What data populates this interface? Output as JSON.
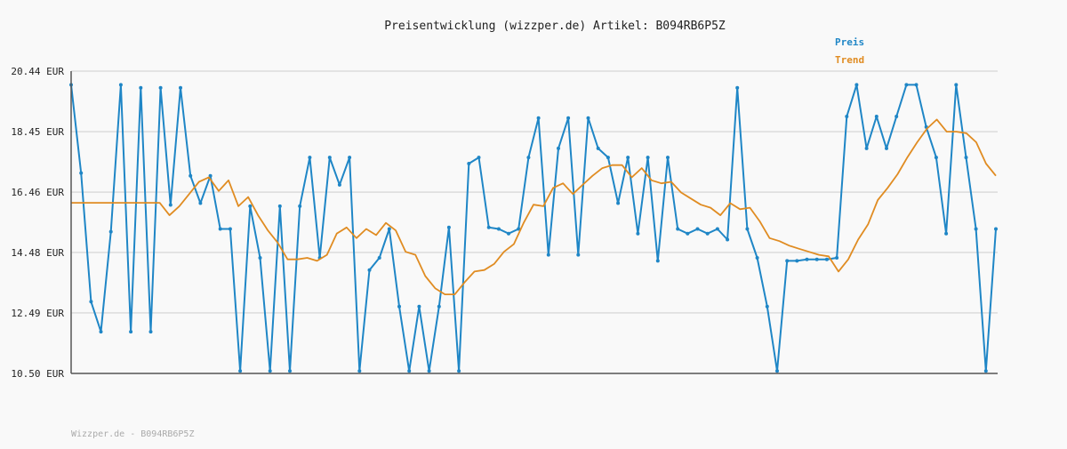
{
  "chart_data": {
    "type": "line",
    "title": "Preisentwicklung (wizzper.de) Artikel: B094RB6P5Z",
    "ylim": [
      10.5,
      20.44
    ],
    "yticks": [
      "20.44 EUR",
      "18.45 EUR",
      "16.46 EUR",
      "14.48 EUR",
      "12.49 EUR",
      "10.50 EUR"
    ],
    "ytick_values": [
      20.44,
      18.45,
      16.46,
      14.48,
      12.49,
      10.5
    ],
    "grid": true,
    "legend_position": "top-right",
    "footer": "Wizzper.de - B094RB6P5Z",
    "series": [
      {
        "name": "Preis",
        "color": "#1f86c6",
        "values": [
          19.99,
          17.09,
          12.86,
          11.87,
          15.16,
          19.99,
          11.87,
          19.89,
          11.87,
          19.89,
          16.04,
          19.89,
          17.0,
          16.1,
          17.0,
          15.25,
          15.25,
          10.58,
          16.0,
          14.3,
          10.58,
          16.0,
          10.58,
          16.0,
          17.6,
          14.3,
          17.6,
          16.7,
          17.6,
          10.58,
          13.9,
          14.3,
          15.25,
          12.7,
          10.58,
          12.7,
          10.58,
          12.7,
          15.3,
          10.58,
          17.4,
          17.6,
          15.3,
          15.25,
          15.1,
          15.25,
          17.6,
          18.9,
          14.4,
          17.9,
          18.9,
          14.4,
          18.9,
          17.9,
          17.6,
          16.1,
          17.6,
          15.1,
          17.6,
          14.2,
          17.6,
          15.25,
          15.1,
          15.25,
          15.1,
          15.25,
          14.9,
          19.89,
          15.25,
          14.3,
          12.7,
          10.58,
          14.2,
          14.2,
          14.25,
          14.25,
          14.25,
          14.3,
          18.95,
          19.99,
          17.9,
          18.95,
          17.9,
          18.95,
          19.99,
          19.99,
          18.6,
          17.6,
          15.1,
          19.99,
          17.6,
          15.25,
          10.58,
          15.25
        ]
      },
      {
        "name": "Trend",
        "color": "#e08c22",
        "values": [
          16.11,
          16.11,
          16.11,
          16.11,
          16.11,
          16.11,
          16.11,
          16.11,
          16.11,
          16.11,
          15.7,
          16.0,
          16.4,
          16.8,
          16.95,
          16.5,
          16.85,
          16.0,
          16.3,
          15.7,
          15.2,
          14.8,
          14.25,
          14.25,
          14.3,
          14.2,
          14.4,
          15.1,
          15.3,
          14.95,
          15.25,
          15.05,
          15.45,
          15.2,
          14.5,
          14.4,
          13.7,
          13.3,
          13.1,
          13.1,
          13.5,
          13.85,
          13.9,
          14.1,
          14.5,
          14.75,
          15.45,
          16.05,
          16.0,
          16.6,
          16.75,
          16.4,
          16.7,
          17.0,
          17.25,
          17.35,
          17.35,
          16.95,
          17.25,
          16.85,
          16.75,
          16.8,
          16.45,
          16.25,
          16.05,
          15.95,
          15.7,
          16.1,
          15.9,
          15.95,
          15.5,
          14.95,
          14.85,
          14.7,
          14.6,
          14.5,
          14.4,
          14.35,
          13.85,
          14.25,
          14.9,
          15.4,
          16.2,
          16.6,
          17.05,
          17.6,
          18.1,
          18.55,
          18.85,
          18.45,
          18.45,
          18.4,
          18.1,
          17.4,
          17.0
        ]
      }
    ]
  }
}
